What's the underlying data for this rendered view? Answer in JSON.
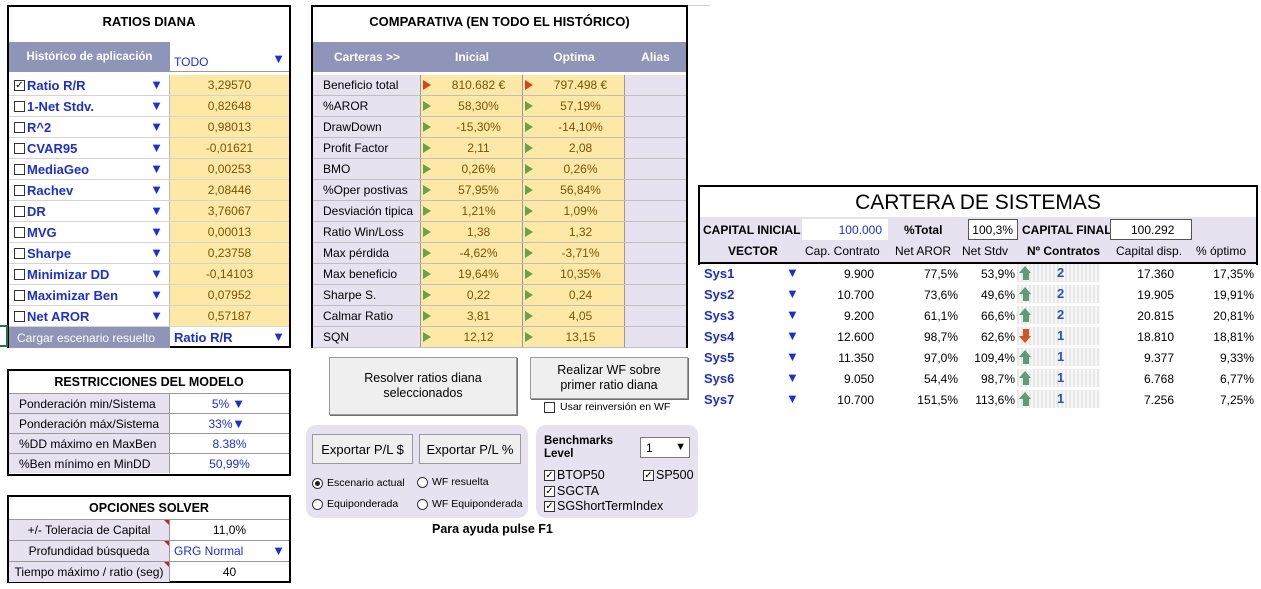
{
  "ratios": {
    "title": "RATIOS DIANA",
    "historico_label": "Histórico de aplicación",
    "historico_value": "TODO",
    "items": [
      {
        "label": "Ratio R/R",
        "value": "3,29570",
        "checked": true
      },
      {
        "label": "1-Net Stdv.",
        "value": "0,82648",
        "checked": false
      },
      {
        "label": "R^2",
        "value": "0,98013",
        "checked": false
      },
      {
        "label": "CVAR95",
        "value": "-0,01621",
        "checked": false
      },
      {
        "label": "MediaGeo",
        "value": "0,00253",
        "checked": false
      },
      {
        "label": "Rachev",
        "value": "2,08446",
        "checked": false
      },
      {
        "label": "DR",
        "value": "3,76067",
        "checked": false
      },
      {
        "label": "MVG",
        "value": "0,00013",
        "checked": false
      },
      {
        "label": "Sharpe",
        "value": "0,23758",
        "checked": false
      },
      {
        "label": "Minimizar DD",
        "value": "-0,14103",
        "checked": false
      },
      {
        "label": "Maximizar Ben",
        "value": "0,07952",
        "checked": false
      },
      {
        "label": "Net AROR",
        "value": "0,57187",
        "checked": false
      }
    ],
    "cargar_label": "Cargar escenario resuelto",
    "cargar_value": "Ratio R/R"
  },
  "comparativa": {
    "title": "COMPARATIVA (EN TODO EL HISTÓRICO)",
    "headers": [
      "Carteras >>",
      "Inicial",
      "Optima",
      "Alias"
    ],
    "rows": [
      {
        "label": "Beneficio total",
        "inicial": "810.682 €",
        "optima": "797.498 €",
        "flag": "red"
      },
      {
        "label": "%AROR",
        "inicial": "58,30%",
        "optima": "57,19%",
        "flag": "green"
      },
      {
        "label": "DrawDown",
        "inicial": "-15,30%",
        "optima": "-14,10%",
        "flag": "green"
      },
      {
        "label": "Profit Factor",
        "inicial": "2,11",
        "optima": "2,08",
        "flag": "green"
      },
      {
        "label": "BMO",
        "inicial": "0,26%",
        "optima": "0,26%",
        "flag": "green"
      },
      {
        "label": "%Oper postivas",
        "inicial": "57,95%",
        "optima": "56,84%",
        "flag": "green"
      },
      {
        "label": "Desviación tipica",
        "inicial": "1,21%",
        "optima": "1,09%",
        "flag": "green"
      },
      {
        "label": "Ratio Win/Loss",
        "inicial": "1,38",
        "optima": "1,32",
        "flag": "green"
      },
      {
        "label": "Max pérdida",
        "inicial": "-4,62%",
        "optima": "-3,71%",
        "flag": "green"
      },
      {
        "label": "Max beneficio",
        "inicial": "19,64%",
        "optima": "10,35%",
        "flag": "green"
      },
      {
        "label": "Sharpe S.",
        "inicial": "0,22",
        "optima": "0,24",
        "flag": "green"
      },
      {
        "label": "Calmar Ratio",
        "inicial": "3,81",
        "optima": "4,05",
        "flag": "green"
      },
      {
        "label": "SQN",
        "inicial": "12,12",
        "optima": "13,15",
        "flag": "green"
      }
    ]
  },
  "buttons": {
    "resolver": "Resolver ratios diana seleccionados",
    "wf": "Realizar WF sobre primer ratio diana",
    "reinversion": "Usar reinversión en WF",
    "exportar_eur": "Exportar P/L $",
    "exportar_pct": "Exportar P/L %"
  },
  "export_options": {
    "escenario_actual": "Escenario actual",
    "wf_resuelta": "WF resuelta",
    "equiponderada": "Equiponderada",
    "wf_equiponderada": "WF Equiponderada"
  },
  "benchmarks": {
    "label": "Benchmarks Level",
    "level": "1",
    "items": [
      "BTOP50",
      "SP500",
      "SGCTA",
      "SGShortTermIndex"
    ]
  },
  "help_text": "Para ayuda pulse F1",
  "restricciones": {
    "title": "RESTRICCIONES DEL MODELO",
    "rows": [
      {
        "label": "Ponderación min/Sistema",
        "value": "5%"
      },
      {
        "label": "Ponderación máx/Sistema",
        "value": "33%"
      },
      {
        "label": "%DD máximo en MaxBen",
        "value": "8.38%"
      },
      {
        "label": "%Ben mínimo en MinDD",
        "value": "50,99%"
      }
    ]
  },
  "solver": {
    "title": "OPCIONES SOLVER",
    "rows": [
      {
        "label": "+/- Toleracia de Capital",
        "value": "11,0%"
      },
      {
        "label": "Profundidad búsqueda",
        "value": "GRG Normal"
      },
      {
        "label": "Tiempo máximo / ratio (seg)",
        "value": "40"
      }
    ]
  },
  "cartera": {
    "title": "CARTERA DE SISTEMAS",
    "capital_inicial_label": "CAPITAL INICIAL",
    "capital_inicial": "100.000",
    "pct_total_label": "%Total",
    "pct_total": "100,3%",
    "capital_final_label": "CAPITAL FINAL",
    "capital_final": "100.292",
    "headers": [
      "VECTOR",
      "Cap. Contrato",
      "Net AROR",
      "Net Stdv",
      "Nº Contratos",
      "Capital disp.",
      "% óptimo"
    ],
    "rows": [
      {
        "name": "Sys1",
        "cap": "9.900",
        "aror": "77,5%",
        "stdv": "53,9%",
        "dir": "up",
        "contratos": "2",
        "disp": "17.360",
        "opt": "17,35%"
      },
      {
        "name": "Sys2",
        "cap": "10.700",
        "aror": "73,6%",
        "stdv": "49,6%",
        "dir": "up",
        "contratos": "2",
        "disp": "19.905",
        "opt": "19,91%"
      },
      {
        "name": "Sys3",
        "cap": "9.200",
        "aror": "61,1%",
        "stdv": "66,6%",
        "dir": "up",
        "contratos": "2",
        "disp": "20.815",
        "opt": "20,81%"
      },
      {
        "name": "Sys4",
        "cap": "12.600",
        "aror": "98,7%",
        "stdv": "62,6%",
        "dir": "down",
        "contratos": "1",
        "disp": "18.810",
        "opt": "18,81%"
      },
      {
        "name": "Sys5",
        "cap": "11.350",
        "aror": "97,0%",
        "stdv": "109,4%",
        "dir": "up",
        "contratos": "1",
        "disp": "9.377",
        "opt": "9,33%"
      },
      {
        "name": "Sys6",
        "cap": "9.050",
        "aror": "54,4%",
        "stdv": "98,7%",
        "dir": "up",
        "contratos": "1",
        "disp": "6.768",
        "opt": "6,77%"
      },
      {
        "name": "Sys7",
        "cap": "10.700",
        "aror": "151,5%",
        "stdv": "113,6%",
        "dir": "up",
        "contratos": "1",
        "disp": "7.256",
        "opt": "7,25%"
      }
    ]
  },
  "colors": {
    "header_blue": "#8e95b8",
    "cell_yellow": "#fee8a6",
    "lavender": "#e6e2ef",
    "accent_blue": "#1a2fd8"
  }
}
